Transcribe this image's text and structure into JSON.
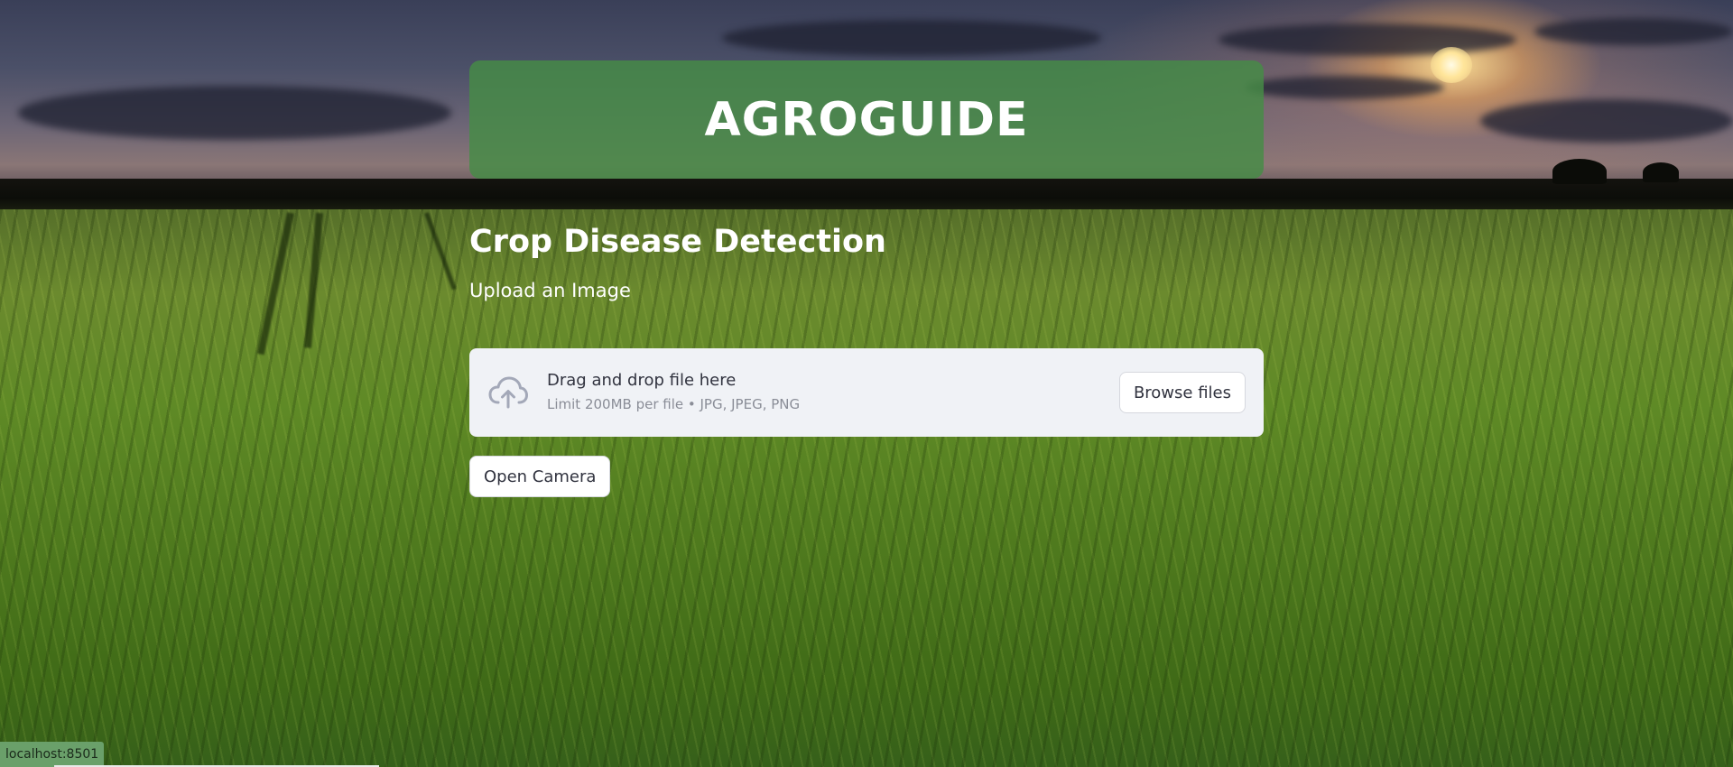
{
  "app": {
    "title": "AGROGUIDE"
  },
  "main": {
    "heading": "Crop Disease Detection",
    "upload_label": "Upload an Image",
    "uploader": {
      "title": "Drag and drop file here",
      "subtitle": "Limit 200MB per file • JPG, JPEG, PNG",
      "browse_label": "Browse files",
      "icon": "cloud-upload-icon"
    },
    "camera_button_label": "Open Camera"
  },
  "status_bar": {
    "url": "localhost:8501"
  },
  "colors": {
    "banner": "#468c46",
    "dropzone_bg": "#f0f2f6",
    "icon": "#a3a8b8",
    "status_bg": "#6aa06a"
  }
}
